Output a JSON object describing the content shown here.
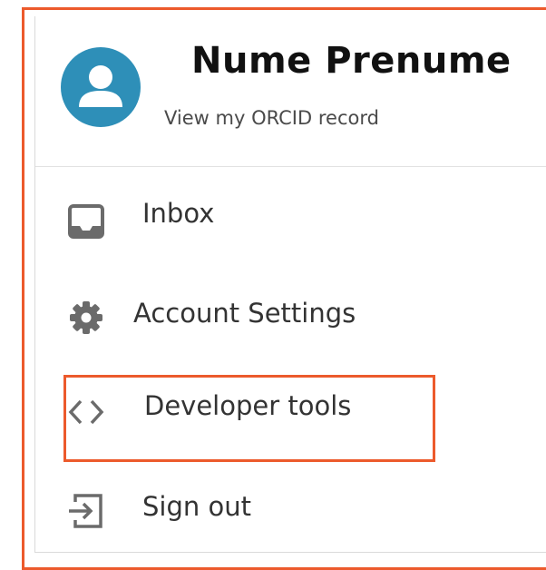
{
  "profile": {
    "name": "Nume Prenume",
    "view_record_label": "View my ORCID record",
    "avatar_icon": "user-avatar-icon"
  },
  "menu": {
    "items": [
      {
        "label": "Inbox",
        "icon": "inbox-icon"
      },
      {
        "label": "Account Settings",
        "icon": "gear-icon"
      },
      {
        "label": "Developer tools",
        "icon": "code-brackets-icon"
      },
      {
        "label": "Sign out",
        "icon": "sign-out-icon"
      }
    ]
  },
  "colors": {
    "accent_border": "#ec5a2c",
    "avatar_bg": "#2e8fb8",
    "icon_gray": "#6b6b6b",
    "text": "#333333"
  }
}
